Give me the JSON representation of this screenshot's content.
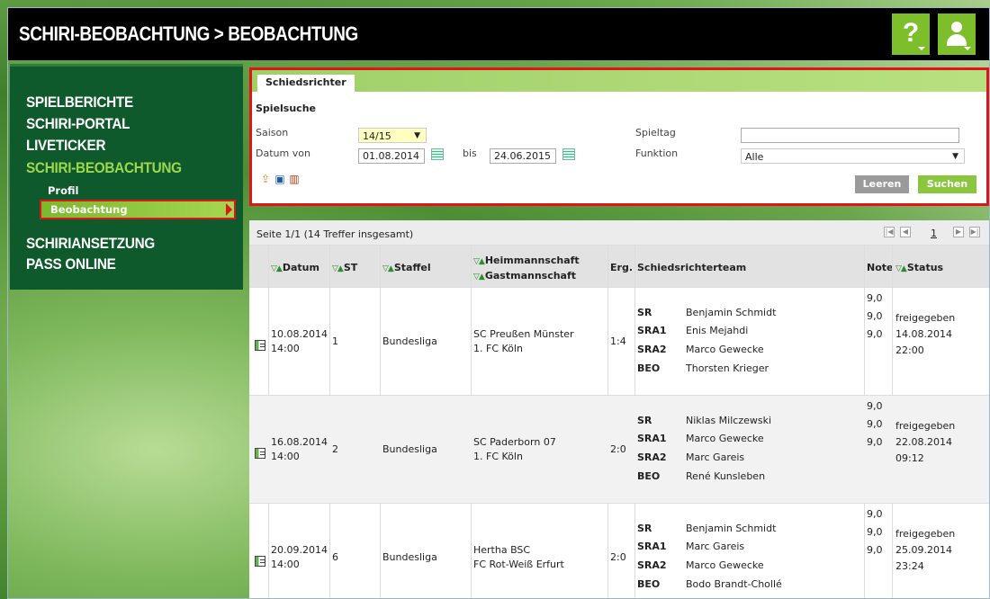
{
  "header": {
    "title": "SCHIRI-BEOBACHTUNG > BEOBACHTUNG",
    "help_glyph": "?",
    "user_icon": "user-icon"
  },
  "nav": {
    "items": [
      "SPIELBERICHTE",
      "SCHIRI-PORTAL",
      "LIVETICKER",
      "SCHIRI-BEOBACHTUNG"
    ],
    "sub_items": [
      "Profil",
      "Beobachtung"
    ],
    "items_bottom": [
      "SCHIRIANSETZUNG",
      "PASS ONLINE"
    ]
  },
  "search": {
    "tab": "Schiedsrichter",
    "section": "Spielsuche",
    "saison_label": "Saison",
    "saison_value": "14/15",
    "datum_von_label": "Datum von",
    "datum_von_value": "01.08.2014",
    "bis_label": "bis",
    "bis_value": "24.06.2015",
    "spieltag_label": "Spieltag",
    "spieltag_value": "",
    "funktion_label": "Funktion",
    "funktion_value": "Alle",
    "leeren_label": "Leeren",
    "suchen_label": "Suchen",
    "colors": {
      "leeren": "#9a9a9a",
      "suchen": "#8cc63f",
      "highlight": "#e0151a"
    }
  },
  "results": {
    "summary": "Seite 1/1 (14 Treffer insgesamt)",
    "page": "1",
    "sort_glyph": "▽▲",
    "headers": {
      "datum": "Datum",
      "st": "ST",
      "staffel": "Staffel",
      "heim": "Heimmannschaft",
      "gast": "Gastmannschaft",
      "erg": "Erg.",
      "team": "Schiedsrichterteam",
      "note": "Note",
      "status": "Status"
    },
    "rows": [
      {
        "date": "10.08.2014",
        "time": "14:00",
        "st": "1",
        "staffel": "Bundesliga",
        "home": "SC Preußen Münster",
        "away": "1. FC Köln",
        "erg": "1:4",
        "team": [
          {
            "role": "SR",
            "name": "Benjamin Schmidt"
          },
          {
            "role": "SRA1",
            "name": "Enis Mejahdi"
          },
          {
            "role": "SRA2",
            "name": "Marco Gewecke"
          },
          {
            "role": "BEO",
            "name": "Thorsten Krieger"
          }
        ],
        "notes": [
          "9,0",
          "9,0",
          "9,0"
        ],
        "status": "freigegeben",
        "status_date": "14.08.2014",
        "status_time": "22:00"
      },
      {
        "date": "16.08.2014",
        "time": "14:00",
        "st": "2",
        "staffel": "Bundesliga",
        "home": "SC Paderborn 07",
        "away": "1. FC Köln",
        "erg": "2:0",
        "team": [
          {
            "role": "SR",
            "name": "Niklas Milczewski"
          },
          {
            "role": "SRA1",
            "name": "Marco Gewecke"
          },
          {
            "role": "SRA2",
            "name": "Marc Gareis"
          },
          {
            "role": "BEO",
            "name": "René Kunsleben"
          }
        ],
        "notes": [
          "9,0",
          "9,0",
          "9,0"
        ],
        "status": "freigegeben",
        "status_date": "22.08.2014",
        "status_time": "09:12"
      },
      {
        "date": "20.09.2014",
        "time": "14:00",
        "st": "6",
        "staffel": "Bundesliga",
        "home": "Hertha BSC",
        "away": "FC Rot-Weiß Erfurt",
        "erg": "2:0",
        "team": [
          {
            "role": "SR",
            "name": "Benjamin Schmidt"
          },
          {
            "role": "SRA1",
            "name": "Marc Gareis"
          },
          {
            "role": "SRA2",
            "name": "Marco Gewecke"
          },
          {
            "role": "BEO",
            "name": "Bodo Brandt-Chollé"
          }
        ],
        "notes": [
          "9,0",
          "9,0",
          "9,0"
        ],
        "status": "freigegeben",
        "status_date": "25.09.2014",
        "status_time": "23:24"
      }
    ]
  }
}
